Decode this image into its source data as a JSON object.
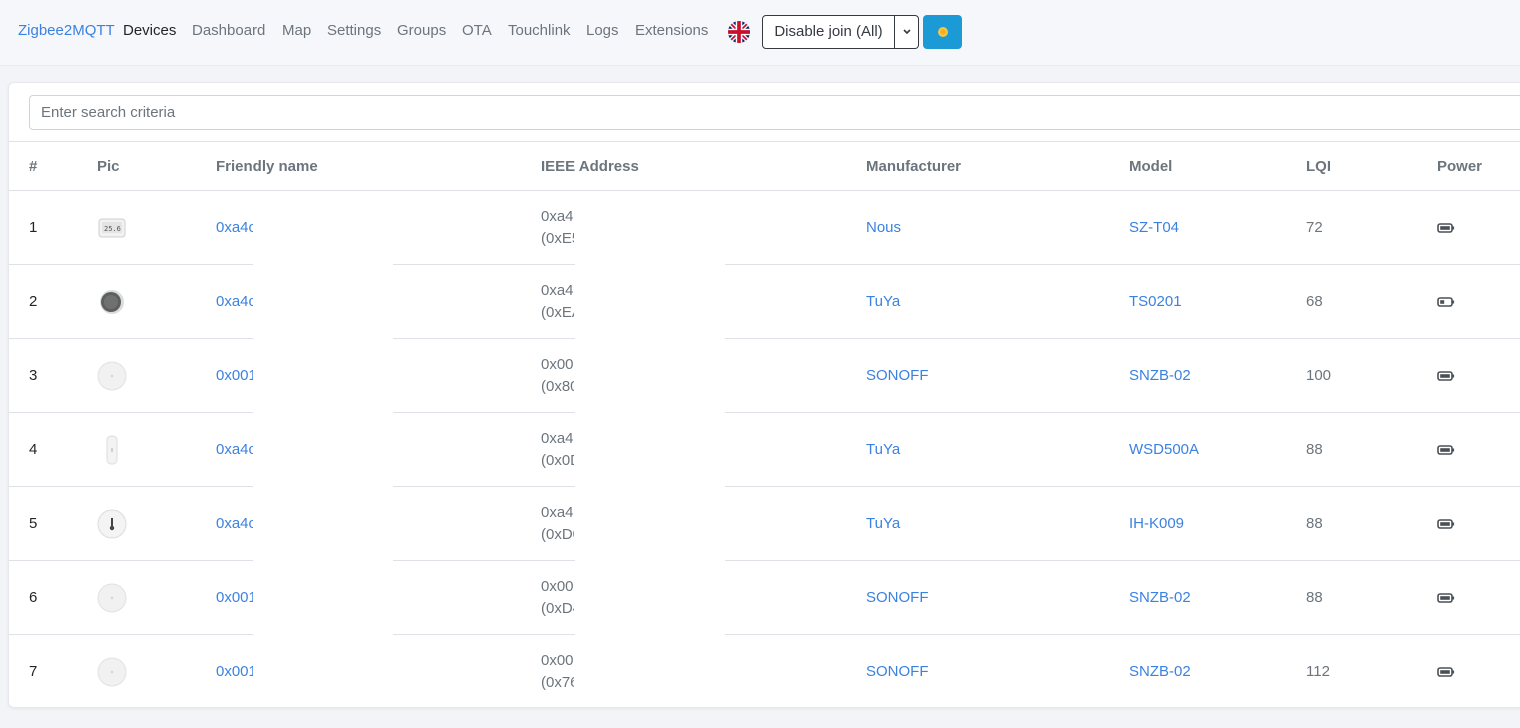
{
  "navbar": {
    "brand": "Zigbee2MQTT",
    "links": [
      "Devices",
      "Dashboard",
      "Map",
      "Settings",
      "Groups",
      "OTA",
      "Touchlink",
      "Logs",
      "Extensions"
    ],
    "active": "Devices",
    "join_button": "Disable join (All)",
    "theme_icon": "sun-icon",
    "language_icon": "uk-flag-icon"
  },
  "search": {
    "placeholder": "Enter search criteria",
    "value": ""
  },
  "table": {
    "columns": [
      "#",
      "Pic",
      "Friendly name",
      "IEEE Address",
      "Manufacturer",
      "Model",
      "LQI",
      "Power"
    ],
    "rows": [
      {
        "num": "1",
        "pic": "thermometer-display-icon",
        "friendly_name": "0xa4c",
        "ieee_1": "0xa4",
        "ieee_2": "(0xE5",
        "manufacturer": "Nous",
        "model": "SZ-T04",
        "lqi": "72",
        "power": "battery-full-icon"
      },
      {
        "num": "2",
        "pic": "round-sensor-dark-icon",
        "friendly_name": "0xa4c",
        "ieee_1": "0xa4",
        "ieee_2": "(0xEA",
        "manufacturer": "TuYa",
        "model": "TS0201",
        "lqi": "68",
        "power": "battery-low-icon"
      },
      {
        "num": "3",
        "pic": "round-sensor-white-icon",
        "friendly_name": "0x001",
        "ieee_1": "0x00",
        "ieee_2": "(0x80",
        "manufacturer": "SONOFF",
        "model": "SNZB-02",
        "lqi": "100",
        "power": "battery-full-icon"
      },
      {
        "num": "4",
        "pic": "slim-sensor-white-icon",
        "friendly_name": "0xa4c",
        "ieee_1": "0xa4",
        "ieee_2": "(0x0D",
        "manufacturer": "TuYa",
        "model": "WSD500A",
        "lqi": "88",
        "power": "battery-full-icon"
      },
      {
        "num": "5",
        "pic": "round-thermometer-icon",
        "friendly_name": "0xa4c",
        "ieee_1": "0xa4",
        "ieee_2": "(0xD0",
        "manufacturer": "TuYa",
        "model": "IH-K009",
        "lqi": "88",
        "power": "battery-full-icon"
      },
      {
        "num": "6",
        "pic": "round-sensor-white-icon",
        "friendly_name": "0x001",
        "ieee_1": "0x00",
        "ieee_2": "(0xD4",
        "manufacturer": "SONOFF",
        "model": "SNZB-02",
        "lqi": "88",
        "power": "battery-full-icon"
      },
      {
        "num": "7",
        "pic": "round-sensor-white-icon",
        "friendly_name": "0x001",
        "ieee_1": "0x00",
        "ieee_2": "(0x76",
        "manufacturer": "SONOFF",
        "model": "SNZB-02",
        "lqi": "112",
        "power": "battery-full-icon"
      }
    ]
  },
  "colors": {
    "link": "#3b82e0",
    "muted": "#6c757d",
    "theme_button": "#1b9ad6"
  }
}
